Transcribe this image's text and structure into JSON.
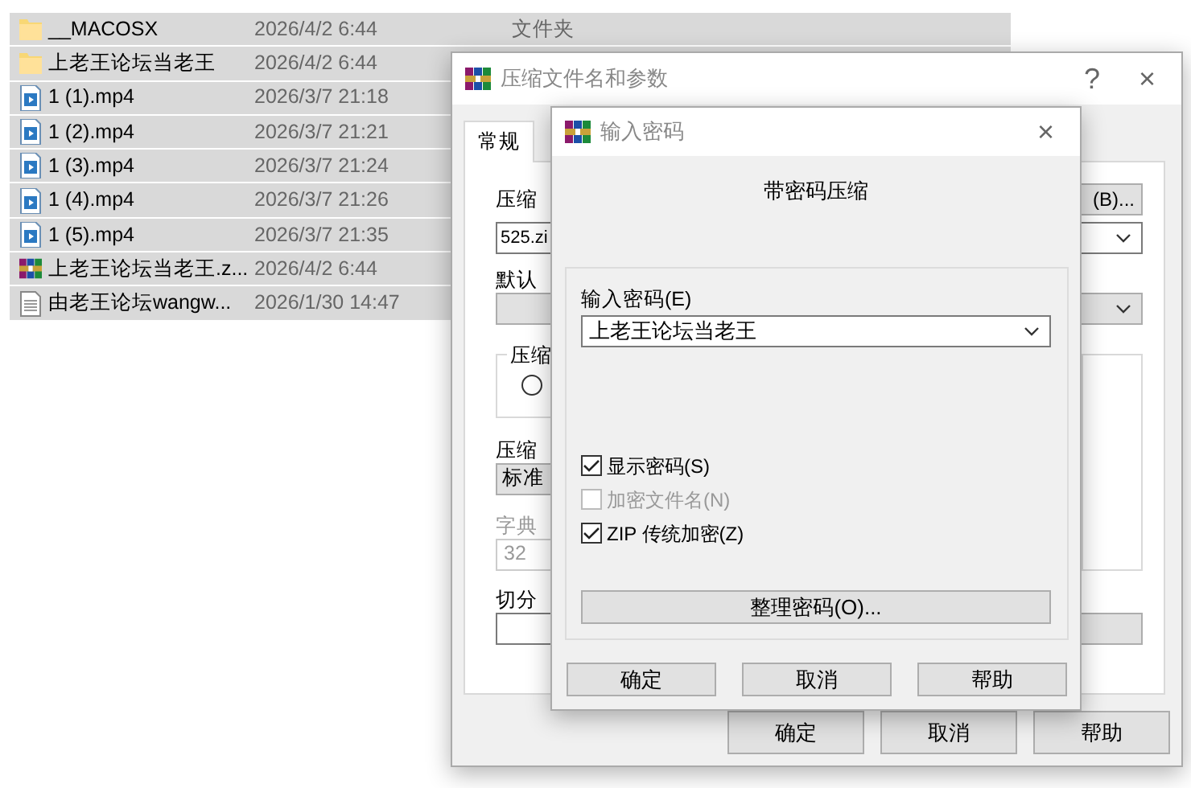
{
  "file_list": {
    "rows": [
      {
        "kind": "folder",
        "name": "__MACOSX",
        "date": "2026/4/2 6:44",
        "type": "文件夹",
        "selected": true
      },
      {
        "kind": "folder",
        "name": "上老王论坛当老王",
        "date": "2026/4/2 6:44",
        "selected": true
      },
      {
        "kind": "video",
        "name": "1 (1).mp4",
        "date": "2026/3/7 21:18",
        "selected": true
      },
      {
        "kind": "video",
        "name": "1 (2).mp4",
        "date": "2026/3/7 21:21",
        "selected": true
      },
      {
        "kind": "video",
        "name": "1 (3).mp4",
        "date": "2026/3/7 21:24",
        "selected": true
      },
      {
        "kind": "video",
        "name": "1 (4).mp4",
        "date": "2026/3/7 21:26",
        "selected": true
      },
      {
        "kind": "video",
        "name": "1 (5).mp4",
        "date": "2026/3/7 21:35",
        "selected": true
      },
      {
        "kind": "archive",
        "name": "上老王论坛当老王.z...",
        "date": "2026/4/2 6:44",
        "selected": true
      },
      {
        "kind": "text",
        "name": "由老王论坛wangw...",
        "date": "2026/1/30 14:47",
        "selected": true
      }
    ]
  },
  "archive_dialog": {
    "title": "压缩文件名和参数",
    "help": "?",
    "close": "×",
    "tabs": [
      {
        "label": "常规",
        "selected": true
      }
    ],
    "archive_name_label": "压缩",
    "browse_button": "(B)...",
    "archive_name_value": "525.zi",
    "profile_label": "默认",
    "format_group_label": "压缩",
    "format_radio": {
      "checked": false
    },
    "method_label": "压缩",
    "method_value": "标准",
    "dictionary_label": "字典",
    "dictionary_value": "32",
    "split_label": "切分",
    "buttons": [
      "确定",
      "取消",
      "帮助"
    ]
  },
  "password_dialog": {
    "title": "输入密码",
    "close": "×",
    "heading": "带密码压缩",
    "password_label": "输入密码(E)",
    "password_value": "上老王论坛当老王",
    "options": [
      {
        "label": "显示密码(S)",
        "checked": true,
        "disabled": false
      },
      {
        "label": "加密文件名(N)",
        "checked": false,
        "disabled": true
      },
      {
        "label": "ZIP 传统加密(Z)",
        "checked": true,
        "disabled": false
      }
    ],
    "organize_button": "整理密码(O)...",
    "buttons": [
      "确定",
      "取消",
      "帮助"
    ]
  }
}
